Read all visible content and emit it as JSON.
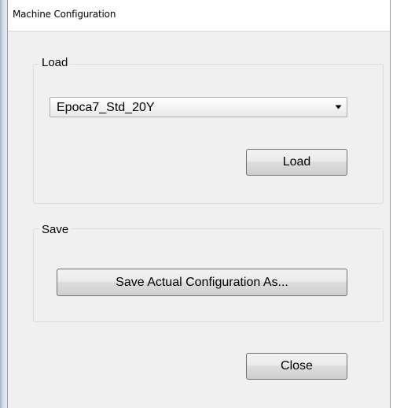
{
  "window": {
    "title": "Machine Configuration"
  },
  "load_group": {
    "label": "Load",
    "selected_config": "Epoca7_Std_20Y",
    "load_button_label": "Load"
  },
  "save_group": {
    "label": "Save",
    "save_as_button_label": "Save Actual Configuration As..."
  },
  "footer": {
    "close_button_label": "Close"
  },
  "icons": {
    "dropdown": "chevron-down-icon"
  }
}
